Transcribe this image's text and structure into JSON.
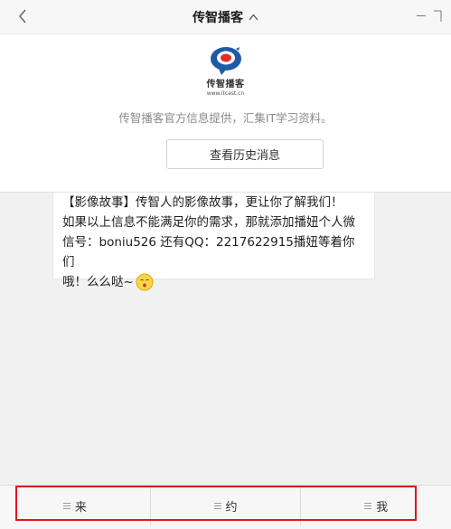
{
  "header": {
    "title": "传智播客",
    "back_icon": "chevron-left-icon",
    "expand_icon": "chevron-up-icon"
  },
  "profile": {
    "logo_name": "传智播客",
    "logo_url": "www.itcast.cn",
    "description": "传智播客官方信息提供，汇集IT学习资料。",
    "history_button": "查看历史消息"
  },
  "message": {
    "line1": "【影像故事】传智人的影像故事，更让你了解我们！",
    "line2": "如果以上信息不能满足你的需求，那就添加播妞个人微",
    "line3": "信号：boniu526 还有QQ：2217622915播妞等着你们",
    "line4": "哦！么么哒~",
    "emoji": "kissing-face-emoji"
  },
  "menu": {
    "items": [
      {
        "label": "来"
      },
      {
        "label": "约"
      },
      {
        "label": "我"
      }
    ],
    "highlight_color": "#e0141e"
  },
  "colors": {
    "background": "#f1f1f1",
    "brand_blue": "#1f5aa6",
    "brand_red": "#e12b2b"
  }
}
